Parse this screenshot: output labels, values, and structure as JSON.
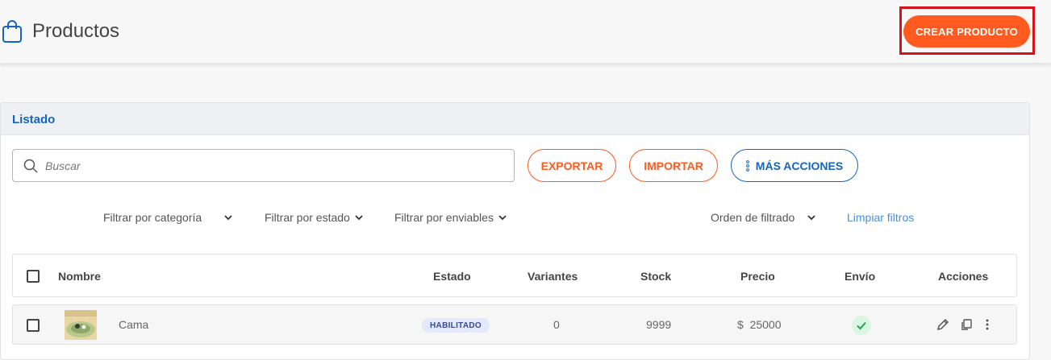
{
  "header": {
    "title": "Productos",
    "icon": "shopping-bag-icon",
    "create_button": "CREAR PRODUCTO"
  },
  "colors": {
    "accent": "#ff5a1f",
    "primary_blue": "#1565c0",
    "highlight": "#d9121a",
    "link": "#4a90d9"
  },
  "listado": {
    "title": "Listado",
    "search": {
      "placeholder": "Buscar",
      "value": ""
    },
    "buttons": {
      "export": "EXPORTAR",
      "import": "IMPORTAR",
      "more": "MÁS ACCIONES"
    },
    "filters": {
      "category": "Filtrar por categoría",
      "status": "Filtrar por estado",
      "shippable": "Filtrar por enviables",
      "order": "Orden de filtrado",
      "clear": "Limpiar filtros"
    },
    "table": {
      "columns": {
        "name": "Nombre",
        "status": "Estado",
        "variants": "Variantes",
        "stock": "Stock",
        "price": "Precio",
        "shipping": "Envío",
        "actions": "Acciones"
      },
      "rows": [
        {
          "name": "Cama",
          "status": "HABILITADO",
          "variants": "0",
          "stock": "9999",
          "price": "$  25000",
          "shipping": "check-icon"
        }
      ]
    }
  }
}
